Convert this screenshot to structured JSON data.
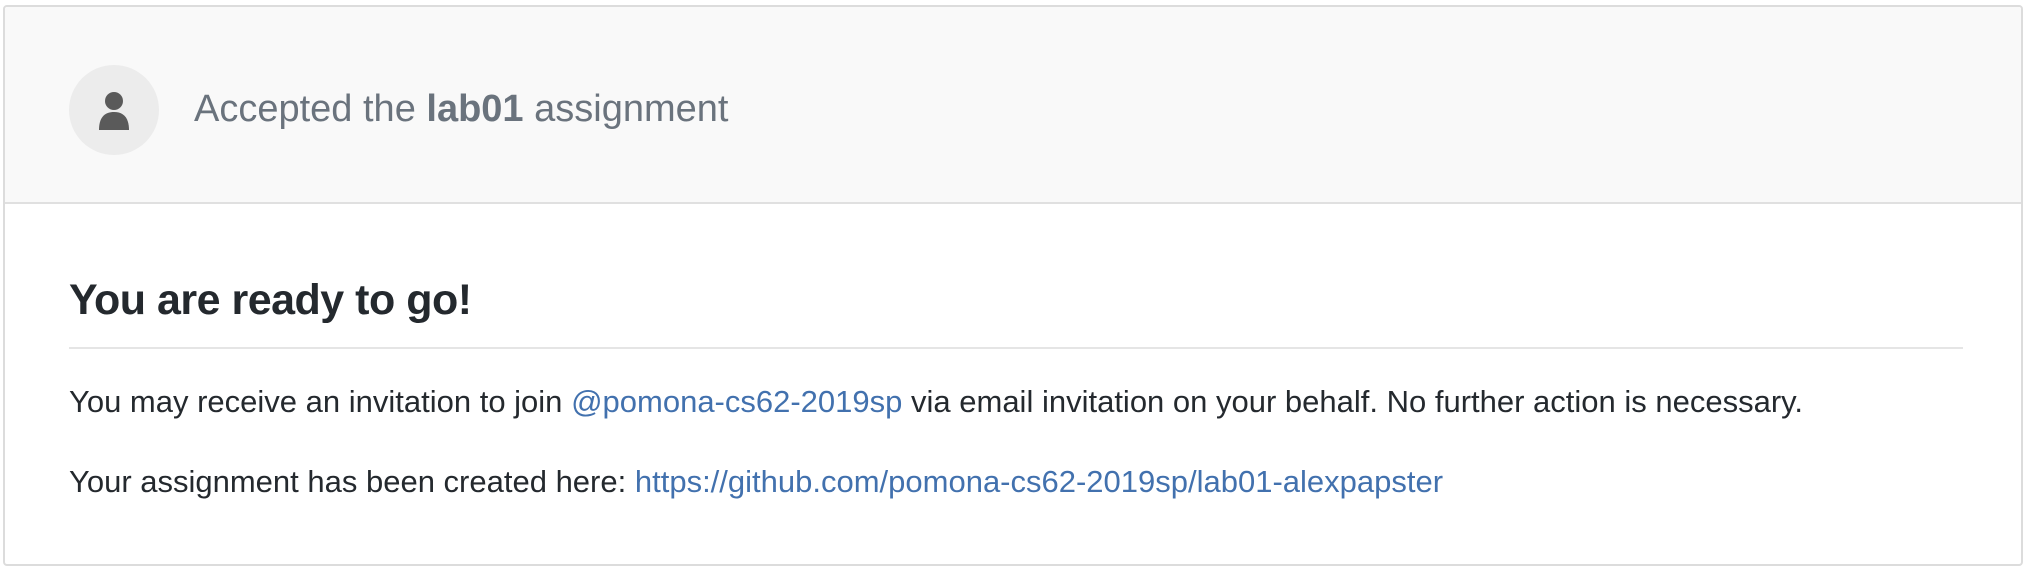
{
  "header": {
    "avatar_icon": "user-silhouette-icon",
    "prefix": "Accepted the",
    "assignment_name": "lab01",
    "suffix": "assignment"
  },
  "body": {
    "title": "You are ready to go!",
    "invite_prefix": "You may receive an invitation to join",
    "org_link": "@pomona-cs62-2019sp",
    "invite_suffix": "via email invitation on your behalf. No further action is necessary.",
    "repo_prefix": "Your assignment has been created here:",
    "repo_link": "https://github.com/pomona-cs62-2019sp/lab01-alexpapster"
  },
  "colors": {
    "link": "#4271ae",
    "header_bg": "#f9f9f9",
    "text": "#24292e",
    "muted": "#6a737d"
  }
}
